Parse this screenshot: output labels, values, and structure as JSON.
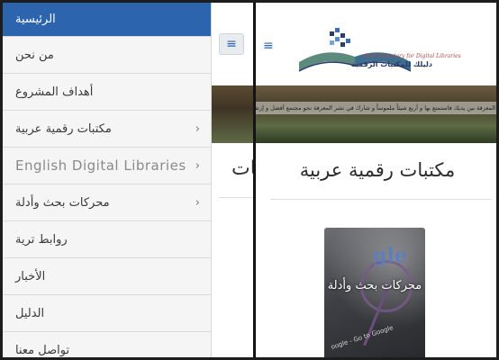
{
  "drawer": {
    "items": [
      {
        "label": "الرئيسية",
        "chevron": ""
      },
      {
        "label": "من نحن",
        "chevron": ""
      },
      {
        "label": "أهداف المشروع",
        "chevron": ""
      },
      {
        "label": "مكتبات رقمية عربية",
        "chevron": "›"
      },
      {
        "label": "English Digital Libraries",
        "chevron": "›"
      },
      {
        "label": "محركات بحث وأدلة",
        "chevron": "›"
      },
      {
        "label": "روابط ترية",
        "chevron": ""
      },
      {
        "label": "الأخبار",
        "chevron": ""
      },
      {
        "label": "الدليل",
        "chevron": ""
      },
      {
        "label": "تواصل معنا",
        "chevron": ""
      }
    ]
  },
  "strip": {
    "menu_icon": "≡",
    "title_fragment": "مكتبات"
  },
  "page": {
    "menu_icon": "≡",
    "logo": {
      "en": "Arab Directory for Digital Libraries",
      "ar": "دليلك للمكتبات الرقمية"
    },
    "hero_caption": "المعرفة بين يديك فاستمتع بها و أربع شيئاً ملموساً و شارك في نشر المعرفة نحو مجتمع أفضل و إرتفاع أفضل و أرقى",
    "section_title": "مكتبات رقمية عربية",
    "card": {
      "label": "محركات بحث وأدلة",
      "brand_fragment": "gle",
      "url_fragment": "oogle - Go to Google"
    }
  },
  "colors": {
    "accent": "#2c64ad",
    "drawer_bg": "#f5f5f5"
  },
  "icons": [
    "hamburger-icon",
    "chevron-right-icon",
    "logo-icon"
  ]
}
